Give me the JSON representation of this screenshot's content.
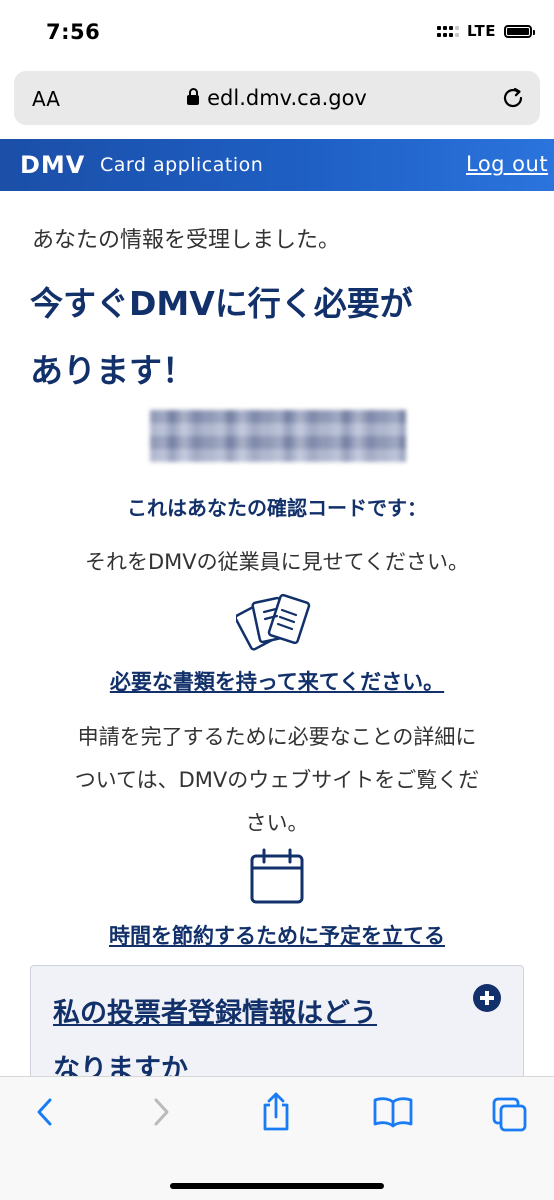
{
  "status": {
    "time": "7:56",
    "network": "LTE"
  },
  "browser": {
    "text_size_label": "AA",
    "url": "edl.dmv.ca.gov"
  },
  "header": {
    "logo": "DMV",
    "subtitle": "Card application",
    "logout": "Log out"
  },
  "content": {
    "received": "あなたの情報を受理しました。",
    "headline_line1": "今すぐDMVに行く必要が",
    "headline_line2": "あります！",
    "code_label": "これはあなたの確認コードです：",
    "show_text": "それをDMVの従業員に見せてください。",
    "docs_link": "必要な書類を持って来てください。",
    "detail_line1": "申請を完了するために必要なことの詳細に",
    "detail_line2": "ついては、DMVのウェブサイトをご覧くだ",
    "detail_line3": "さい。",
    "appointment_link": "時間を節約するために予定を立てる",
    "accordion_title_line1": "私の投票者登録情報はどう",
    "accordion_title_line2": "なりますか"
  },
  "toolbar": {
    "items": [
      "back-icon",
      "forward-icon",
      "share-icon",
      "bookmarks-icon",
      "tabs-icon"
    ]
  },
  "colors": {
    "header": "#1e5fc4",
    "navy": "#12306a",
    "ios_blue": "#1a7cf5"
  }
}
